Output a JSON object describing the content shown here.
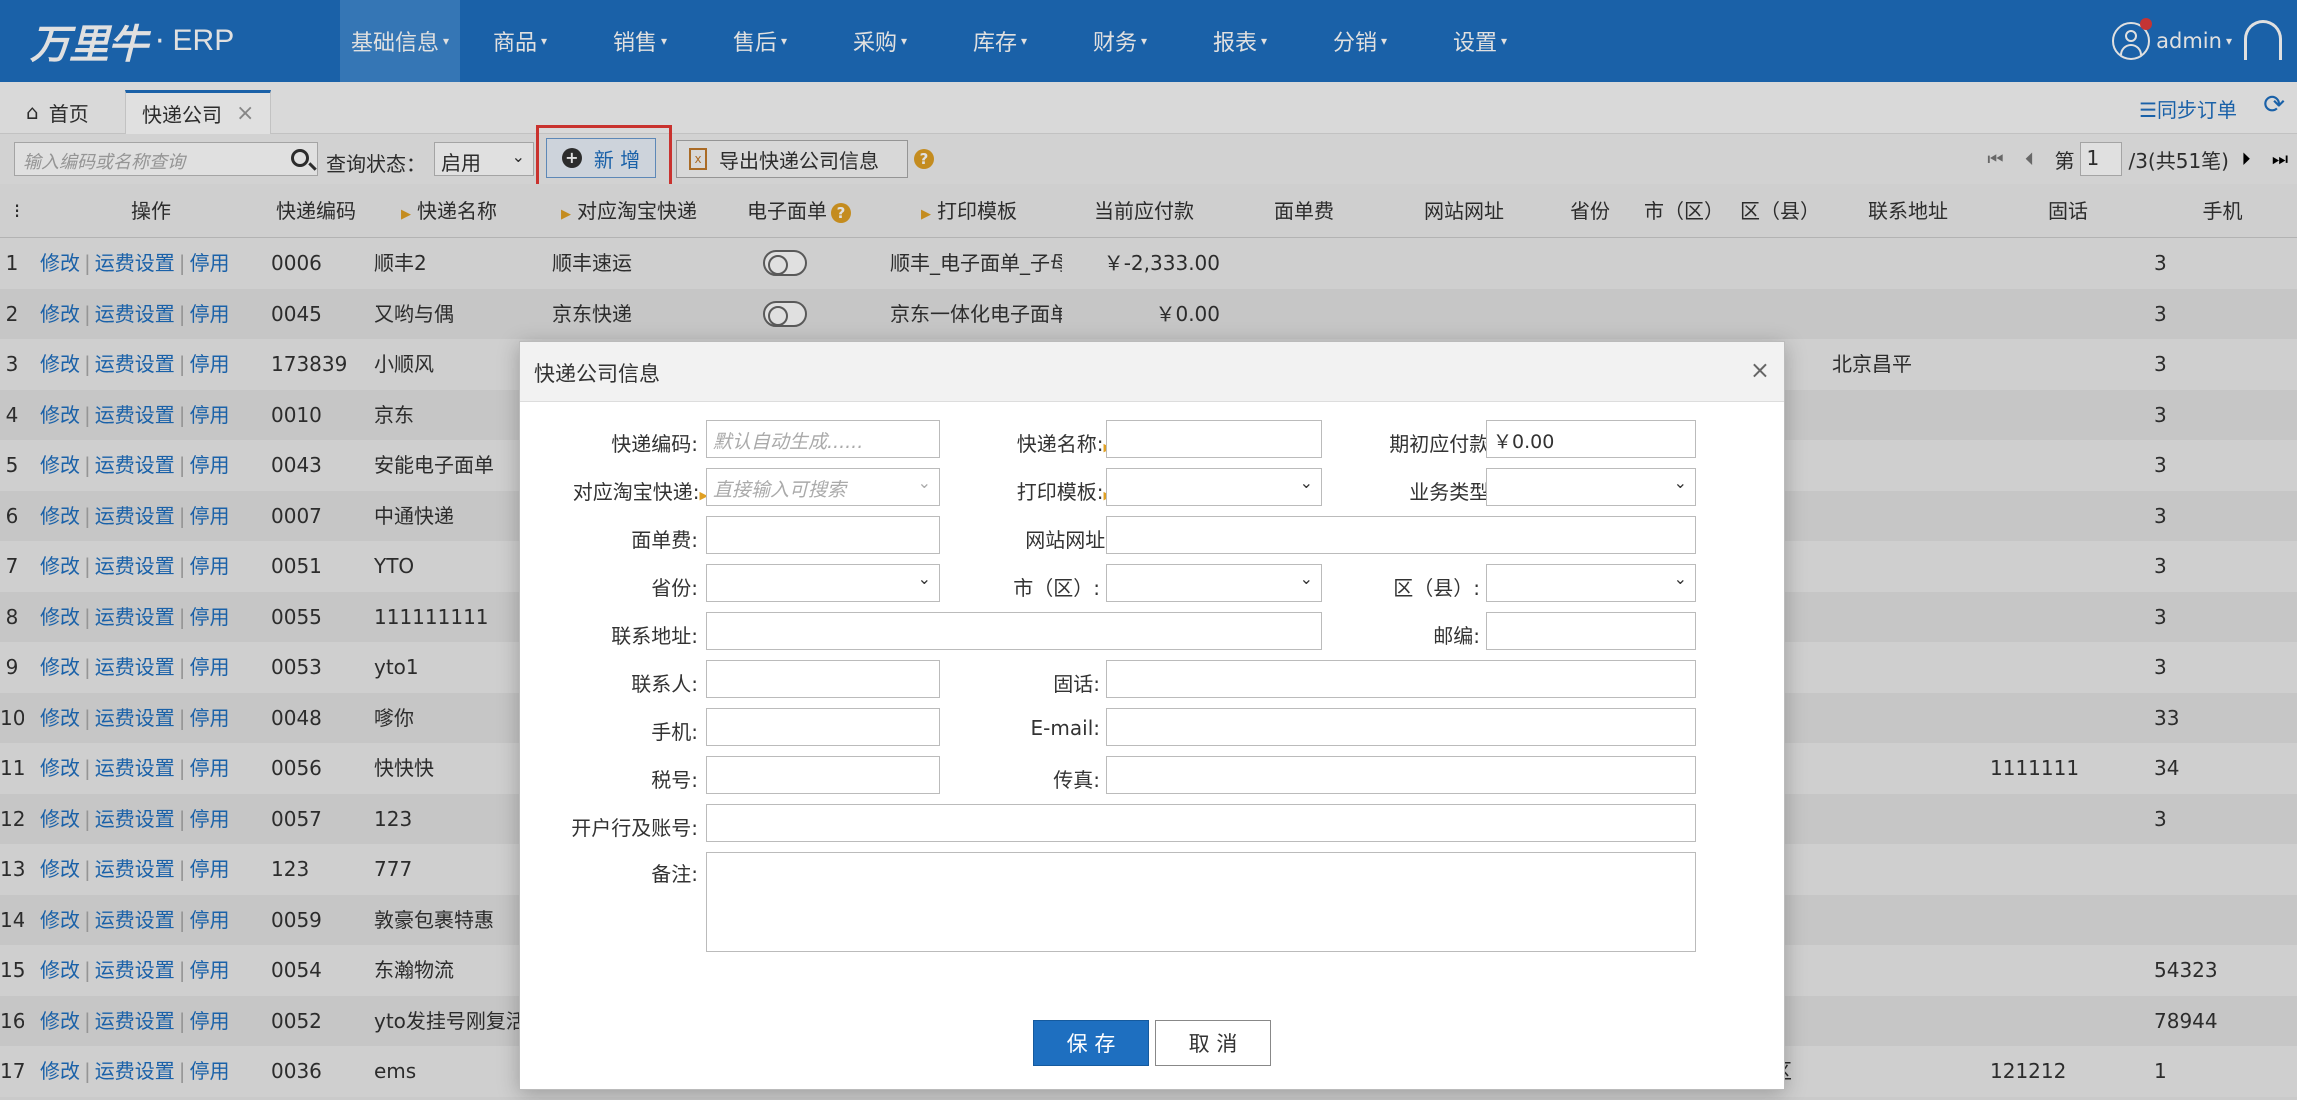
{
  "app": {
    "brand": "万里牛",
    "dot": "·",
    "product": "ERP"
  },
  "nav": [
    "基础信息",
    "商品",
    "销售",
    "售后",
    "采购",
    "库存",
    "财务",
    "报表",
    "分销",
    "设置"
  ],
  "user": {
    "name": "admin"
  },
  "tabs": {
    "home": "首页",
    "current": "快递公司"
  },
  "sync_label": "☰同步订单",
  "toolbar": {
    "search_placeholder": "输入编码或名称查询",
    "query_label": "查询状态：",
    "query_value": "启用",
    "add_label": "新 增",
    "export_label": "导出快递公司信息"
  },
  "pager": {
    "page_label": "第",
    "page": "1",
    "total": "/3(共51笔)"
  },
  "columns": {
    "op": "操作",
    "code": "快递编码",
    "name": "快递名称",
    "taobao": "对应淘宝快递",
    "eface": "电子面单",
    "tpl": "打印模板",
    "balance": "当前应付款",
    "fee": "面单费",
    "site": "网站网址",
    "prov": "省份",
    "city": "市（区）",
    "dist": "区（县）",
    "addr": "联系地址",
    "tel": "固话",
    "mobile": "手机"
  },
  "op_links": {
    "edit": "修改",
    "freight": "运费设置",
    "disable": "停用"
  },
  "rows": [
    {
      "no": "1",
      "code": "0006",
      "name": "顺丰2",
      "taobao": "顺丰速运",
      "tpl": "顺丰_电子面单_子母件",
      "balance": "￥-2,333.00",
      "addr": "",
      "tel": "",
      "mobile": "3"
    },
    {
      "no": "2",
      "code": "0045",
      "name": "又哟与偶",
      "taobao": "京东快递",
      "tpl": "京东一体化电子面单",
      "balance": "￥0.00",
      "addr": "",
      "tel": "",
      "mobile": "3"
    },
    {
      "no": "3",
      "code": "173839",
      "name": "小顺风",
      "taobao": "",
      "tpl": "",
      "balance": "",
      "addr": "北京昌平",
      "tel": "",
      "mobile": "3"
    },
    {
      "no": "4",
      "code": "0010",
      "name": "京东",
      "taobao": "",
      "tpl": "",
      "balance": "",
      "addr": "",
      "tel": "",
      "mobile": "3"
    },
    {
      "no": "5",
      "code": "0043",
      "name": "安能电子面单",
      "taobao": "",
      "tpl": "",
      "balance": "",
      "addr": "",
      "tel": "",
      "mobile": "3"
    },
    {
      "no": "6",
      "code": "0007",
      "name": "中通快递",
      "taobao": "",
      "tpl": "",
      "balance": "",
      "addr": "",
      "tel": "",
      "mobile": "3"
    },
    {
      "no": "7",
      "code": "0051",
      "name": "YTO",
      "taobao": "",
      "tpl": "",
      "balance": "",
      "addr": "",
      "tel": "",
      "mobile": "3"
    },
    {
      "no": "8",
      "code": "0055",
      "name": "111111111",
      "taobao": "",
      "tpl": "",
      "balance": "",
      "addr": "",
      "tel": "",
      "mobile": "3"
    },
    {
      "no": "9",
      "code": "0053",
      "name": "yto1",
      "taobao": "",
      "tpl": "",
      "balance": "",
      "addr": "",
      "tel": "",
      "mobile": "3"
    },
    {
      "no": "10",
      "code": "0048",
      "name": "嗲你",
      "taobao": "",
      "tpl": "",
      "balance": "",
      "addr": "",
      "tel": "",
      "mobile": "33"
    },
    {
      "no": "11",
      "code": "0056",
      "name": "快快快",
      "taobao": "",
      "tpl": "",
      "balance": "",
      "addr": "",
      "tel": "1111111",
      "mobile": "34"
    },
    {
      "no": "12",
      "code": "0057",
      "name": "123",
      "taobao": "",
      "tpl": "",
      "balance": "",
      "addr": "",
      "tel": "",
      "mobile": "3"
    },
    {
      "no": "13",
      "code": "123",
      "name": "777",
      "taobao": "",
      "tpl": "",
      "balance": "",
      "addr": "",
      "tel": "",
      "mobile": ""
    },
    {
      "no": "14",
      "code": "0059",
      "name": "敦豪包裹特惠",
      "taobao": "",
      "tpl": "",
      "balance": "",
      "addr": "",
      "tel": "",
      "mobile": ""
    },
    {
      "no": "15",
      "code": "0054",
      "name": "东瀚物流",
      "taobao": "",
      "tpl": "",
      "balance": "",
      "addr": "",
      "tel": "",
      "mobile": "54323"
    },
    {
      "no": "16",
      "code": "0052",
      "name": "yto发挂号刚复活",
      "taobao": "",
      "tpl": "",
      "balance": "",
      "addr": "",
      "tel": "",
      "mobile": "78944"
    },
    {
      "no": "17",
      "code": "0036",
      "name": "ems",
      "taobao": "",
      "tpl": "",
      "balance": "",
      "addr": "",
      "dist": "区",
      "tel": "121212",
      "mobile": "1"
    }
  ],
  "modal": {
    "title": "快递公司信息",
    "close": "×",
    "labels": {
      "code": "快递编码:",
      "name": "快递名称:",
      "init_pay": "期初应付款:",
      "taobao": "对应淘宝快递:",
      "tpl": "打印模板:",
      "biz": "业务类型:",
      "fee": "面单费:",
      "site": "网站网址:",
      "prov": "省份:",
      "city": "市（区）:",
      "dist": "区（县）:",
      "addr": "联系地址:",
      "zip": "邮编:",
      "contact": "联系人:",
      "tel": "固话:",
      "mobile": "手机:",
      "email": "E-mail:",
      "tax": "税号:",
      "fax": "传真:",
      "bank": "开户行及账号:",
      "remark": "备注:"
    },
    "placeholders": {
      "code": "默认自动生成......",
      "taobao": "直接输入可搜索"
    },
    "values": {
      "init_pay": "￥0.00"
    },
    "save": "保 存",
    "cancel": "取 消"
  }
}
